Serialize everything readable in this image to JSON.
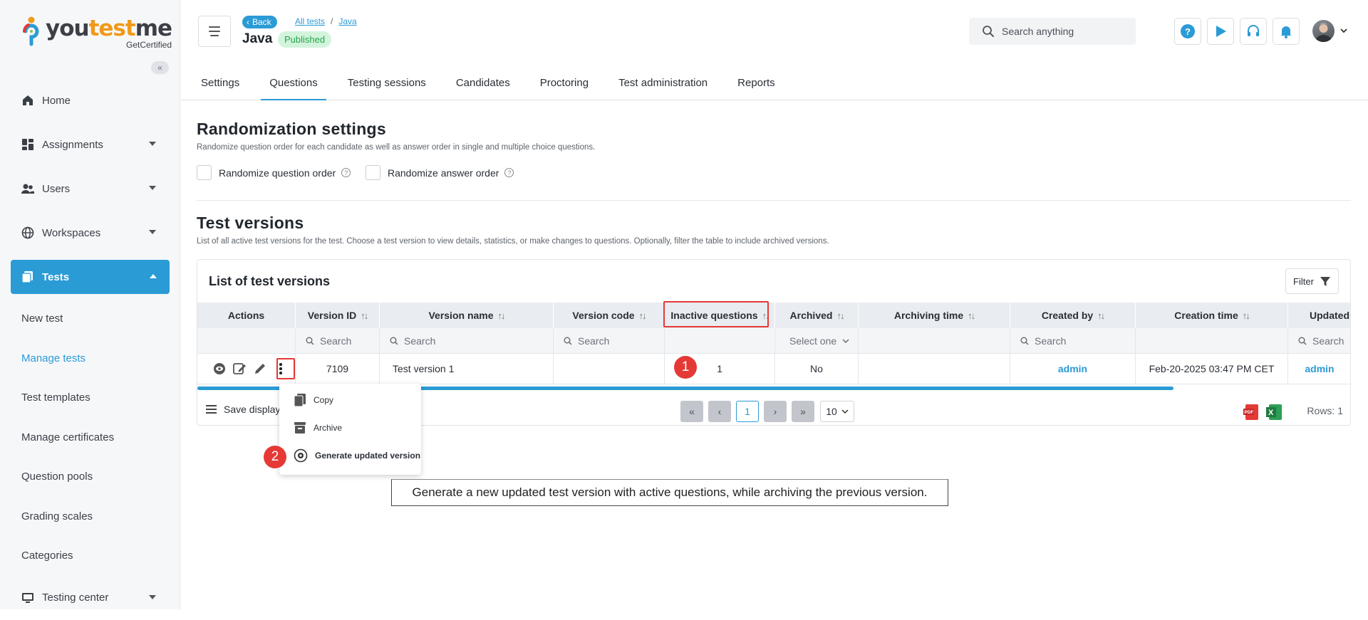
{
  "brand": {
    "name_part1": "you",
    "name_part2": "test",
    "name_part3": "me",
    "tagline": "GetCertified",
    "accent": "#f09a1a",
    "primary": "#2b9bd6"
  },
  "sidebar": {
    "items": [
      {
        "label": "Home",
        "icon": "home-icon"
      },
      {
        "label": "Assignments",
        "icon": "dashboard-icon",
        "expandable": true
      },
      {
        "label": "Users",
        "icon": "users-icon",
        "expandable": true
      },
      {
        "label": "Workspaces",
        "icon": "globe-icon",
        "expandable": true
      },
      {
        "label": "Tests",
        "icon": "tests-icon",
        "expandable": true,
        "active": true
      }
    ],
    "sub_items": [
      {
        "label": "New test"
      },
      {
        "label": "Manage tests",
        "current": true
      },
      {
        "label": "Test templates"
      },
      {
        "label": "Manage certificates"
      },
      {
        "label": "Question pools"
      },
      {
        "label": "Grading scales"
      },
      {
        "label": "Categories"
      }
    ],
    "bottom_item": {
      "label": "Testing center",
      "icon": "testing-center-icon"
    }
  },
  "header": {
    "back_label": "Back",
    "breadcrumb": [
      "All tests",
      "Java"
    ],
    "breadcrumb_sep": "/",
    "title": "Java",
    "status_badge": "Published",
    "search_placeholder": "Search anything",
    "help_symbol": "?"
  },
  "tabs": [
    "Settings",
    "Questions",
    "Testing sessions",
    "Candidates",
    "Proctoring",
    "Test administration",
    "Reports"
  ],
  "active_tab": "Questions",
  "randomization": {
    "title": "Randomization settings",
    "description": "Randomize question order for each candidate as well as answer order in single and multiple choice questions.",
    "question_order_label": "Randomize question order",
    "answer_order_label": "Randomize answer order"
  },
  "test_versions": {
    "title": "Test versions",
    "description": "List of all active test versions for the test. Choose a test version to view details, statistics, or make changes to questions. Optionally, filter the table to include archived versions.",
    "card_title": "List of test versions",
    "filter_label": "Filter",
    "columns": [
      "Actions",
      "Version ID",
      "Version name",
      "Version code",
      "Inactive questions",
      "Archived",
      "Archiving time",
      "Created by",
      "Creation time",
      "Updated"
    ],
    "search_placeholder": "Search",
    "select_placeholder": "Select one",
    "rows": [
      {
        "version_id": "7109",
        "version_name": "Test version 1",
        "version_code": "",
        "inactive_questions": "1",
        "archived": "No",
        "archiving_time": "",
        "created_by": "admin",
        "creation_time": "Feb-20-2025 03:47 PM CET",
        "updated_by": "admin"
      }
    ],
    "save_display_label": "Save display",
    "current_page": "1",
    "rows_per_page": "10",
    "rows_count_label": "Rows: 1"
  },
  "actions_menu": {
    "items": [
      "Copy",
      "Archive",
      "Generate updated version"
    ]
  },
  "annotations": {
    "marker_1": "1",
    "marker_2": "2",
    "highlight_color": "#e53935",
    "tooltip": "Generate a new updated test version with active questions, while archiving the previous version."
  }
}
